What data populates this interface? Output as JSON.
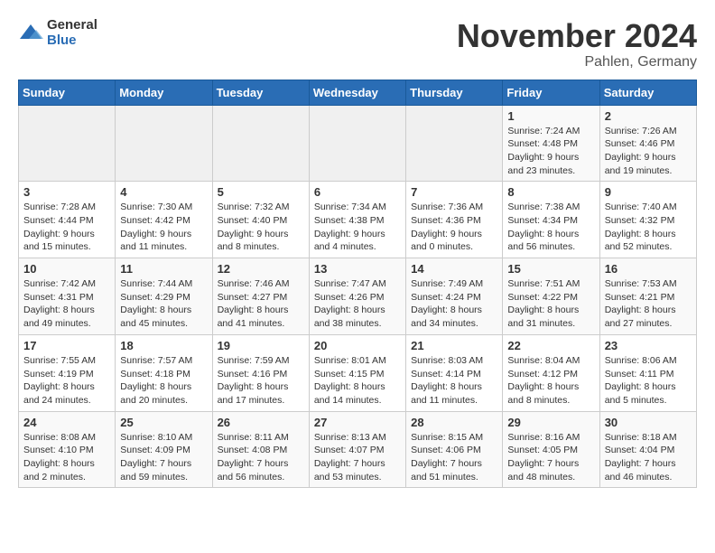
{
  "logo": {
    "general": "General",
    "blue": "Blue"
  },
  "title": "November 2024",
  "location": "Pahlen, Germany",
  "weekdays": [
    "Sunday",
    "Monday",
    "Tuesday",
    "Wednesday",
    "Thursday",
    "Friday",
    "Saturday"
  ],
  "weeks": [
    [
      {
        "day": "",
        "info": ""
      },
      {
        "day": "",
        "info": ""
      },
      {
        "day": "",
        "info": ""
      },
      {
        "day": "",
        "info": ""
      },
      {
        "day": "",
        "info": ""
      },
      {
        "day": "1",
        "info": "Sunrise: 7:24 AM\nSunset: 4:48 PM\nDaylight: 9 hours\nand 23 minutes."
      },
      {
        "day": "2",
        "info": "Sunrise: 7:26 AM\nSunset: 4:46 PM\nDaylight: 9 hours\nand 19 minutes."
      }
    ],
    [
      {
        "day": "3",
        "info": "Sunrise: 7:28 AM\nSunset: 4:44 PM\nDaylight: 9 hours\nand 15 minutes."
      },
      {
        "day": "4",
        "info": "Sunrise: 7:30 AM\nSunset: 4:42 PM\nDaylight: 9 hours\nand 11 minutes."
      },
      {
        "day": "5",
        "info": "Sunrise: 7:32 AM\nSunset: 4:40 PM\nDaylight: 9 hours\nand 8 minutes."
      },
      {
        "day": "6",
        "info": "Sunrise: 7:34 AM\nSunset: 4:38 PM\nDaylight: 9 hours\nand 4 minutes."
      },
      {
        "day": "7",
        "info": "Sunrise: 7:36 AM\nSunset: 4:36 PM\nDaylight: 9 hours\nand 0 minutes."
      },
      {
        "day": "8",
        "info": "Sunrise: 7:38 AM\nSunset: 4:34 PM\nDaylight: 8 hours\nand 56 minutes."
      },
      {
        "day": "9",
        "info": "Sunrise: 7:40 AM\nSunset: 4:32 PM\nDaylight: 8 hours\nand 52 minutes."
      }
    ],
    [
      {
        "day": "10",
        "info": "Sunrise: 7:42 AM\nSunset: 4:31 PM\nDaylight: 8 hours\nand 49 minutes."
      },
      {
        "day": "11",
        "info": "Sunrise: 7:44 AM\nSunset: 4:29 PM\nDaylight: 8 hours\nand 45 minutes."
      },
      {
        "day": "12",
        "info": "Sunrise: 7:46 AM\nSunset: 4:27 PM\nDaylight: 8 hours\nand 41 minutes."
      },
      {
        "day": "13",
        "info": "Sunrise: 7:47 AM\nSunset: 4:26 PM\nDaylight: 8 hours\nand 38 minutes."
      },
      {
        "day": "14",
        "info": "Sunrise: 7:49 AM\nSunset: 4:24 PM\nDaylight: 8 hours\nand 34 minutes."
      },
      {
        "day": "15",
        "info": "Sunrise: 7:51 AM\nSunset: 4:22 PM\nDaylight: 8 hours\nand 31 minutes."
      },
      {
        "day": "16",
        "info": "Sunrise: 7:53 AM\nSunset: 4:21 PM\nDaylight: 8 hours\nand 27 minutes."
      }
    ],
    [
      {
        "day": "17",
        "info": "Sunrise: 7:55 AM\nSunset: 4:19 PM\nDaylight: 8 hours\nand 24 minutes."
      },
      {
        "day": "18",
        "info": "Sunrise: 7:57 AM\nSunset: 4:18 PM\nDaylight: 8 hours\nand 20 minutes."
      },
      {
        "day": "19",
        "info": "Sunrise: 7:59 AM\nSunset: 4:16 PM\nDaylight: 8 hours\nand 17 minutes."
      },
      {
        "day": "20",
        "info": "Sunrise: 8:01 AM\nSunset: 4:15 PM\nDaylight: 8 hours\nand 14 minutes."
      },
      {
        "day": "21",
        "info": "Sunrise: 8:03 AM\nSunset: 4:14 PM\nDaylight: 8 hours\nand 11 minutes."
      },
      {
        "day": "22",
        "info": "Sunrise: 8:04 AM\nSunset: 4:12 PM\nDaylight: 8 hours\nand 8 minutes."
      },
      {
        "day": "23",
        "info": "Sunrise: 8:06 AM\nSunset: 4:11 PM\nDaylight: 8 hours\nand 5 minutes."
      }
    ],
    [
      {
        "day": "24",
        "info": "Sunrise: 8:08 AM\nSunset: 4:10 PM\nDaylight: 8 hours\nand 2 minutes."
      },
      {
        "day": "25",
        "info": "Sunrise: 8:10 AM\nSunset: 4:09 PM\nDaylight: 7 hours\nand 59 minutes."
      },
      {
        "day": "26",
        "info": "Sunrise: 8:11 AM\nSunset: 4:08 PM\nDaylight: 7 hours\nand 56 minutes."
      },
      {
        "day": "27",
        "info": "Sunrise: 8:13 AM\nSunset: 4:07 PM\nDaylight: 7 hours\nand 53 minutes."
      },
      {
        "day": "28",
        "info": "Sunrise: 8:15 AM\nSunset: 4:06 PM\nDaylight: 7 hours\nand 51 minutes."
      },
      {
        "day": "29",
        "info": "Sunrise: 8:16 AM\nSunset: 4:05 PM\nDaylight: 7 hours\nand 48 minutes."
      },
      {
        "day": "30",
        "info": "Sunrise: 8:18 AM\nSunset: 4:04 PM\nDaylight: 7 hours\nand 46 minutes."
      }
    ]
  ]
}
